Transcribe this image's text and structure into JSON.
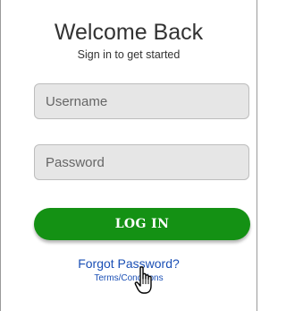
{
  "header": {
    "title": "Welcome Back",
    "subtitle": "Sign in to get started"
  },
  "form": {
    "username": {
      "placeholder": "Username",
      "value": ""
    },
    "password": {
      "placeholder": "Password",
      "value": ""
    },
    "login_label": "LOG IN"
  },
  "links": {
    "forgot_password": "Forgot Password?",
    "terms": "Terms/Conditions"
  },
  "cursor": {
    "icon": "hand-pointer-icon"
  },
  "colors": {
    "login_button": "#149114",
    "link": "#1a4fb5",
    "field_background": "#e6e6e6"
  }
}
